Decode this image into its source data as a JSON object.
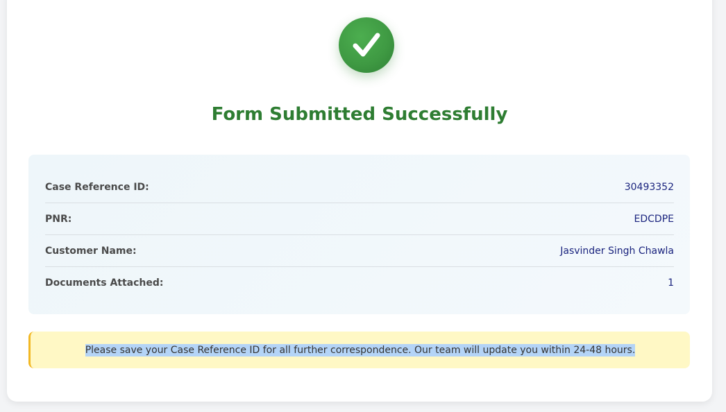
{
  "header": {
    "title": "Form Submitted Successfully"
  },
  "icons": {
    "success": "checkmark-icon"
  },
  "colors": {
    "success_green": "#2e7d32",
    "value_navy": "#1a237e",
    "notice_bg": "#fff8c5",
    "notice_border": "#f2b824",
    "selection_highlight": "#b4d4f7"
  },
  "details": [
    {
      "label": "Case Reference ID:",
      "value": "30493352"
    },
    {
      "label": "PNR:",
      "value": "EDCDPE"
    },
    {
      "label": "Customer Name:",
      "value": "Jasvinder Singh Chawla"
    },
    {
      "label": "Documents Attached:",
      "value": "1"
    }
  ],
  "notice": {
    "text": "Please save your Case Reference ID for all further correspondence. Our team will update you within 24-48 hours."
  }
}
